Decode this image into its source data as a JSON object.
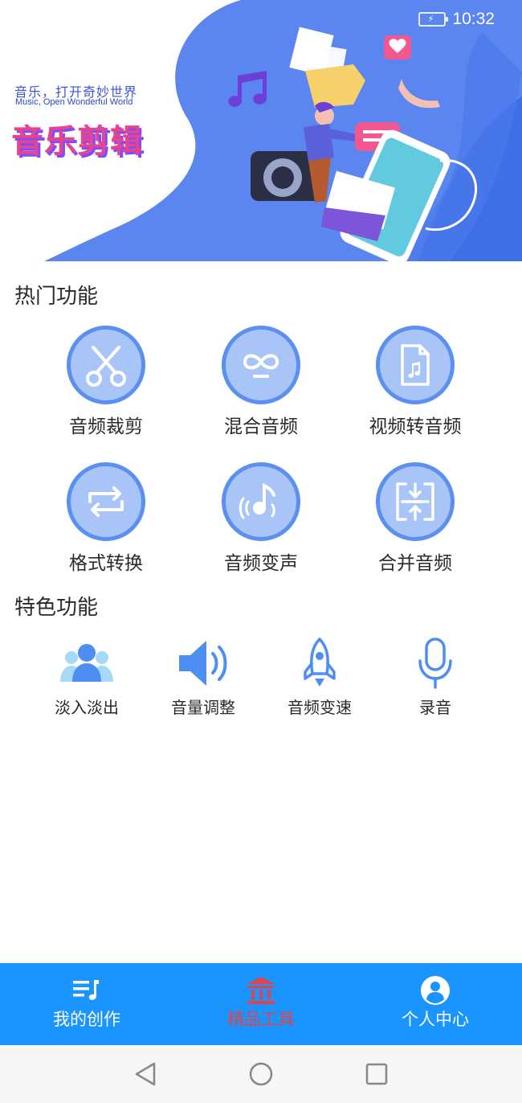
{
  "status_bar": {
    "time": "10:32",
    "battery_icon": "battery-charging-icon"
  },
  "banner": {
    "tagline_cn": "音乐，打开奇妙世界",
    "tagline_en": "Music, Open Wonderful World",
    "title": "音乐剪辑"
  },
  "sections": {
    "hot_title": "热门功能",
    "feature_title": "特色功能"
  },
  "hot_functions": [
    {
      "label": "音频裁剪",
      "icon": "scissors-icon"
    },
    {
      "label": "混合音频",
      "icon": "infinity-icon"
    },
    {
      "label": "视频转音频",
      "icon": "music-file-icon"
    },
    {
      "label": "格式转换",
      "icon": "repeat-icon"
    },
    {
      "label": "音频变声",
      "icon": "voice-note-icon"
    },
    {
      "label": "合并音频",
      "icon": "merge-icon"
    }
  ],
  "feature_functions": [
    {
      "label": "淡入淡出",
      "icon": "people-icon"
    },
    {
      "label": "音量调整",
      "icon": "speaker-icon"
    },
    {
      "label": "音频变速",
      "icon": "rocket-icon"
    },
    {
      "label": "录音",
      "icon": "microphone-icon"
    }
  ],
  "bottom_nav": [
    {
      "label": "我的创作",
      "icon": "playlist-icon",
      "active": false
    },
    {
      "label": "精品工具",
      "icon": "bank-icon",
      "active": true
    },
    {
      "label": "个人中心",
      "icon": "user-icon",
      "active": false
    }
  ],
  "colors": {
    "accent_blue": "#1a95ff",
    "icon_blue": "#5b8ff0",
    "icon_fill": "#a9c4f7",
    "active_red": "#e2424a",
    "title_pink": "#e8448d"
  }
}
